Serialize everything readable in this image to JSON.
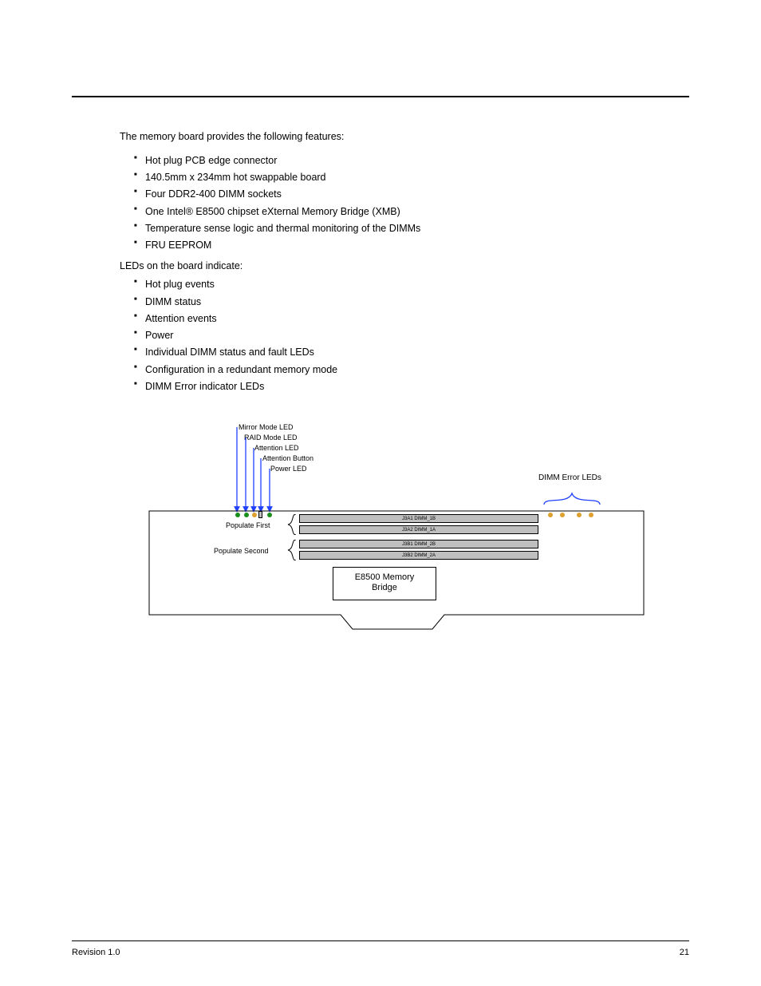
{
  "intro": "The memory board provides the following features:",
  "features_a": [
    "Hot plug PCB edge connector",
    "140.5mm x 234mm hot swappable board",
    "Four DDR2-400 DIMM sockets",
    "One Intel® E8500 chipset eXternal Memory Bridge (XMB)",
    "Temperature sense logic and thermal monitoring of the DIMMs",
    "FRU EEPROM"
  ],
  "subpara": "LEDs on the board indicate:",
  "features_b": [
    "Hot plug events",
    "DIMM status",
    "Attention events",
    "Power",
    "Individual DIMM status and fault LEDs",
    "Configuration in a redundant memory mode",
    "DIMM Error indicator LEDs"
  ],
  "diagram": {
    "led_labels": {
      "mirror": "Mirror Mode LED",
      "raid": "RAID Mode LED",
      "attn_led": "Attention LED",
      "attn_btn": "Attention Button",
      "power": "Power LED"
    },
    "dimm_err_label": "DIMM Error LEDs",
    "pop_first": "Populate First",
    "pop_second": "Populate Second",
    "slots": [
      "J3A1 DIMM_1B",
      "J3A2 DIMM_1A",
      "J3B1 DIMM_2B",
      "J3B2 DIMM_2A"
    ],
    "chip_line1": "E8500 Memory",
    "chip_line2": "Bridge"
  },
  "footer": {
    "left": "Revision 1.0",
    "right": "21"
  }
}
